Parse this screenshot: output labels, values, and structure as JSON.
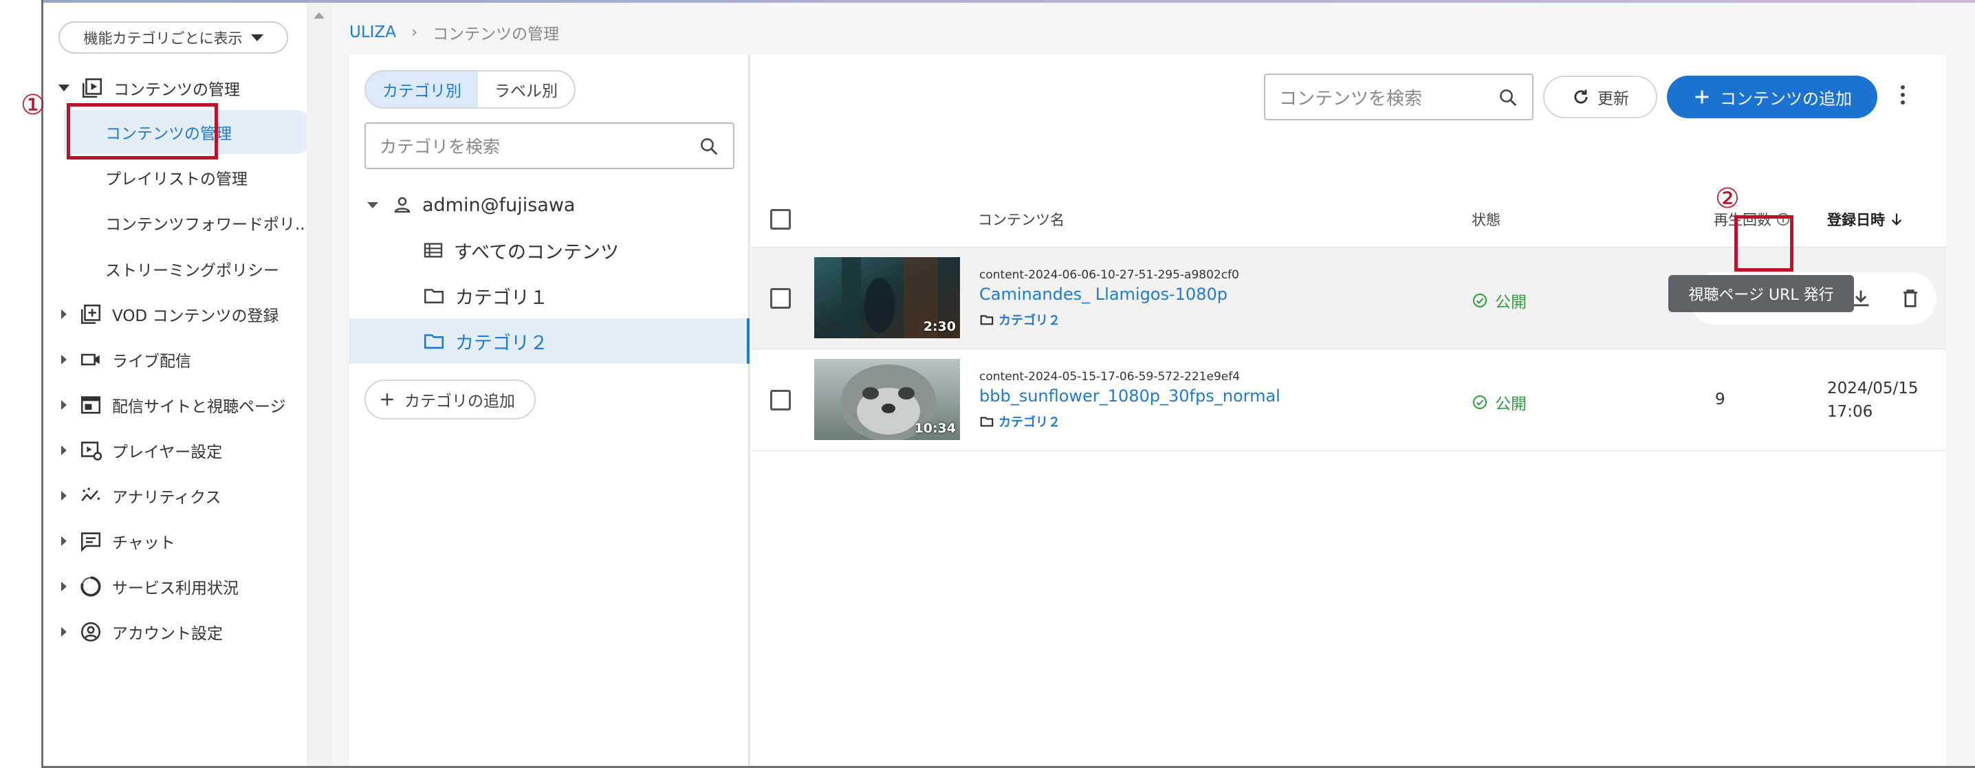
{
  "sidebar": {
    "category_select": "機能カテゴリごとに表示",
    "groups": [
      {
        "label": "コンテンツの管理",
        "expanded": true,
        "icon": "play-box-icon"
      },
      {
        "label": "VOD コンテンツの登録",
        "icon": "add-box-icon"
      },
      {
        "label": "ライブ配信",
        "icon": "video-camera-icon"
      },
      {
        "label": "配信サイトと視聴ページ",
        "icon": "web-page-icon"
      },
      {
        "label": "プレイヤー設定",
        "icon": "player-settings-icon"
      },
      {
        "label": "アナリティクス",
        "icon": "analytics-icon"
      },
      {
        "label": "チャット",
        "icon": "chat-icon"
      },
      {
        "label": "サービス利用状況",
        "icon": "usage-icon"
      },
      {
        "label": "アカウント設定",
        "icon": "account-icon"
      }
    ],
    "sub_items": [
      {
        "label": "コンテンツの管理",
        "active": true
      },
      {
        "label": "プレイリストの管理"
      },
      {
        "label": "コンテンツフォワードポリ..."
      },
      {
        "label": "ストリーミングポリシー"
      }
    ]
  },
  "annotations": {
    "one": "①",
    "two": "②"
  },
  "breadcrumb": {
    "root": "ULIZA",
    "separator": "›",
    "current": "コンテンツの管理"
  },
  "category_panel": {
    "tab_by_category": "カテゴリ別",
    "tab_by_label": "ラベル別",
    "search_placeholder": "カテゴリを検索",
    "tree": {
      "user": "admin@fujisawa",
      "all": "すべてのコンテンツ",
      "cat1": "カテゴリ１",
      "cat2": "カテゴリ２"
    },
    "add_category": "カテゴリの追加"
  },
  "content_panel": {
    "search_placeholder": "コンテンツを検索",
    "refresh_label": "更新",
    "add_label": "コンテンツの追加",
    "columns": {
      "name": "コンテンツ名",
      "status": "状態",
      "plays": "再生回数",
      "registered": "登録日時"
    },
    "rows": [
      {
        "id": "content-2024-06-06-10-27-51-295-a9802cf0",
        "title": "Caminandes_ Llamigos-1080p",
        "category": "カテゴリ２",
        "duration": "2:30",
        "status": "公開",
        "plays": "",
        "date": "",
        "time": ""
      },
      {
        "id": "content-2024-05-15-17-06-59-572-221e9ef4",
        "title": "bbb_sunflower_1080p_30fps_normal",
        "category": "カテゴリ２",
        "duration": "10:34",
        "status": "公開",
        "plays": "9",
        "date": "2024/05/15",
        "time": "17:06"
      }
    ],
    "tooltip": "視聴ページ URL 発行"
  },
  "colors": {
    "accent": "#1a73d0",
    "status_green": "#2e9e3e",
    "annotation_red": "#c0102a"
  }
}
